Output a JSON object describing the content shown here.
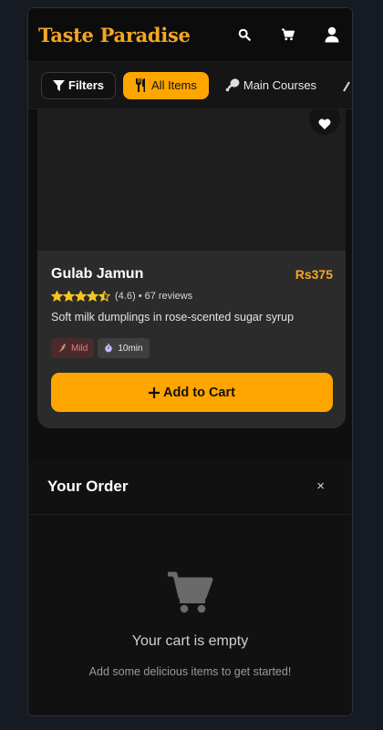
{
  "header": {
    "brand": "Taste Paradise",
    "icons": [
      "search-icon",
      "cart-icon",
      "user-icon"
    ]
  },
  "filters": {
    "filters_label": "Filters",
    "chips": [
      {
        "label": "All Items",
        "icon": "utensils-icon",
        "active": true
      },
      {
        "label": "Main Courses",
        "icon": "drumstick-icon",
        "active": false
      }
    ]
  },
  "item": {
    "name": "Gulab Jamun",
    "price": "Rs375",
    "rating_value": 4.5,
    "rating_text": "(4.6)",
    "reviews": "• 67 reviews",
    "description": "Soft milk dumplings in rose-scented sugar syrup",
    "spice": "Mild",
    "time": "10min",
    "add_label": "Add to Cart"
  },
  "order": {
    "title": "Your Order",
    "close": "×",
    "empty_title": "Your cart is empty",
    "empty_subtitle": "Add some delicious items to get started!"
  },
  "colors": {
    "accent": "#ffa500",
    "brand": "#f5a623",
    "bg": "#0f0f0f",
    "card": "#2b2b2b"
  }
}
